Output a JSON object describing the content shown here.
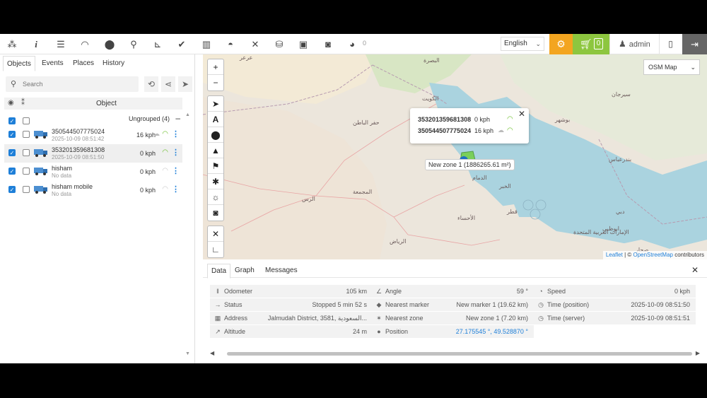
{
  "toolbar": {
    "icons": [
      "grid-icon",
      "info-icon",
      "sliders-icon",
      "gauge-icon",
      "pin-icon",
      "search-icon",
      "chart-icon",
      "check-icon",
      "book-icon",
      "car-icon",
      "tools-icon",
      "database-icon",
      "window-icon",
      "camera-icon",
      "chat-icon"
    ],
    "chat_count": "0",
    "language": "English",
    "cart_count": "0",
    "user": "admin"
  },
  "left_panel": {
    "tabs": [
      "Objects",
      "Events",
      "Places",
      "History"
    ],
    "search_placeholder": "Search",
    "column_title": "Object",
    "group_label": "Ungrouped (4)",
    "objects": [
      {
        "name": "350544507775024",
        "time": "2025-10-09 08:51:42",
        "speed": "16 kph",
        "signal": "green",
        "cloud": true,
        "checked": true,
        "selected": false
      },
      {
        "name": "353201359681308",
        "time": "2025-10-09 08:51:50",
        "speed": "0 kph",
        "signal": "green",
        "cloud": false,
        "checked": true,
        "selected": true
      },
      {
        "name": "hisham",
        "time": "No data",
        "speed": "0 kph",
        "signal": "gray",
        "cloud": false,
        "checked": true,
        "selected": false
      },
      {
        "name": "hisham mobile",
        "time": "No data",
        "speed": "0 kph",
        "signal": "gray",
        "cloud": false,
        "checked": true,
        "selected": false
      }
    ]
  },
  "map": {
    "map_type": "OSM Map",
    "popup": [
      {
        "object": "353201359681308",
        "speed": "0 kph"
      },
      {
        "object": "350544507775024",
        "speed": "16 kph"
      }
    ],
    "zone_tooltip": "New zone 1 (1886265.61 m²)",
    "attribution_leaflet": "Leaflet",
    "attribution_sep": " | © ",
    "attribution_osm": "OpenStreetMap",
    "attribution_rest": " contributors",
    "labels": [
      "البصرة",
      "الكويت",
      "حفر الباطن",
      "الدمام",
      "الرياض",
      "الأحساء",
      "قطر",
      "بوشهر",
      "دبي",
      "ابوظبي",
      "بندرعباس",
      "المجمعة",
      "الرس",
      "الإمارات العربية المتحدة",
      "صحار",
      "عرعر",
      "سيرجان",
      "الخبر"
    ]
  },
  "details": {
    "tabs": [
      "Data",
      "Graph",
      "Messages"
    ],
    "col1": [
      {
        "icon": "odometer-icon",
        "glyph": "‖",
        "label": "Odometer",
        "value": "105 km"
      },
      {
        "icon": "status-icon",
        "glyph": "→",
        "label": "Status",
        "value": "Stopped 5 min 52 s"
      },
      {
        "icon": "address-icon",
        "glyph": "▦",
        "label": "Address",
        "value": "Jalmudah District, السعودية ,3581..."
      },
      {
        "icon": "altitude-icon",
        "glyph": "↗",
        "label": "Altitude",
        "value": "24 m"
      }
    ],
    "col2": [
      {
        "icon": "angle-icon",
        "glyph": "∠",
        "label": "Angle",
        "value": "59 °"
      },
      {
        "icon": "marker-icon",
        "glyph": "◆",
        "label": "Nearest marker",
        "value": "New marker 1 (19.62 km)"
      },
      {
        "icon": "zone-icon",
        "glyph": "✶",
        "label": "Nearest zone",
        "value": "New zone 1 (7.20 km)"
      },
      {
        "icon": "position-icon",
        "glyph": "●",
        "label": "Position",
        "value": "27.175545 °, 49.528870 °"
      }
    ],
    "col3": [
      {
        "icon": "speed-icon",
        "glyph": "◔",
        "label": "Speed",
        "value": "0 kph"
      },
      {
        "icon": "clock-icon",
        "glyph": "◷",
        "label": "Time (position)",
        "value": "2025-10-09 08:51:50"
      },
      {
        "icon": "clock-icon",
        "glyph": "◷",
        "label": "Time (server)",
        "value": "2025-10-09 08:51:51"
      }
    ]
  }
}
